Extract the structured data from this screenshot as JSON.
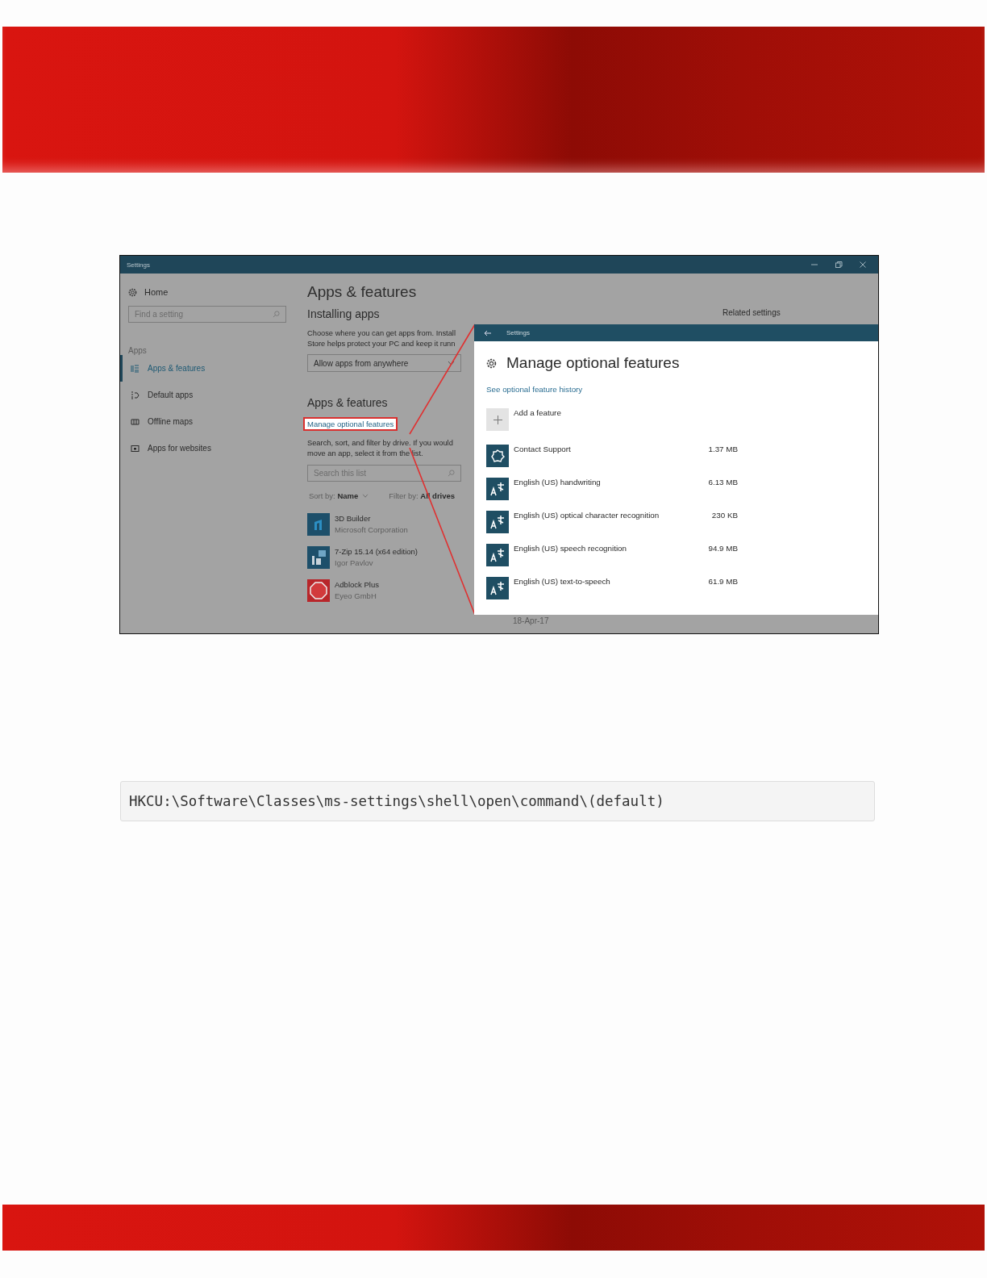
{
  "screenshot": {
    "window": {
      "title": "Settings"
    },
    "sidebar": {
      "home": "Home",
      "search_placeholder": "Find a setting",
      "section": "Apps",
      "items": [
        {
          "label": "Apps & features",
          "kind": "list",
          "selected": true
        },
        {
          "label": "Default apps",
          "kind": "default",
          "selected": false
        },
        {
          "label": "Offline maps",
          "kind": "map",
          "selected": false
        },
        {
          "label": "Apps for websites",
          "kind": "web",
          "selected": false
        }
      ]
    },
    "main": {
      "title": "Apps & features",
      "installing_heading": "Installing apps",
      "installing_lines": [
        "Choose where you can get apps from. Install",
        "Store helps protect your PC and keep it runn"
      ],
      "dropdown": "Allow apps from anywhere",
      "section_heading": "Apps & features",
      "link": "Manage optional features",
      "search_lines": [
        "Search, sort, and filter by drive. If you would",
        "move an app, select it from the list."
      ],
      "search_placeholder": "Search this list",
      "sort_label": "Sort by:",
      "sort_value": "Name",
      "filter_label": "Filter by:",
      "filter_value": "All drives",
      "apps": [
        {
          "name": "3D Builder",
          "publisher": "Microsoft Corporation",
          "kind": "builder"
        },
        {
          "name": "7-Zip 15.14 (x64 edition)",
          "publisher": "Igor Pavlov",
          "kind": "zip"
        },
        {
          "name": "Adblock Plus",
          "publisher": "Eyeo GmbH",
          "kind": "adblock"
        }
      ],
      "related_settings": "Related settings",
      "date": "18-Apr-17"
    },
    "popup": {
      "title": "Settings",
      "heading": "Manage optional features",
      "link": "See optional feature history",
      "add": "Add a feature",
      "features": [
        {
          "name": "Contact Support",
          "size": "1.37 MB",
          "kind": "support"
        },
        {
          "name": "English (US) handwriting",
          "size": "6.13 MB",
          "kind": "language"
        },
        {
          "name": "English (US) optical character recognition",
          "size": "230 KB",
          "kind": "language"
        },
        {
          "name": "English (US) speech recognition",
          "size": "94.9 MB",
          "kind": "language"
        },
        {
          "name": "English (US) text-to-speech",
          "size": "61.9 MB",
          "kind": "language"
        }
      ]
    }
  },
  "code": "HKCU:\\Software\\Classes\\ms-settings\\shell\\open\\command\\(default)"
}
